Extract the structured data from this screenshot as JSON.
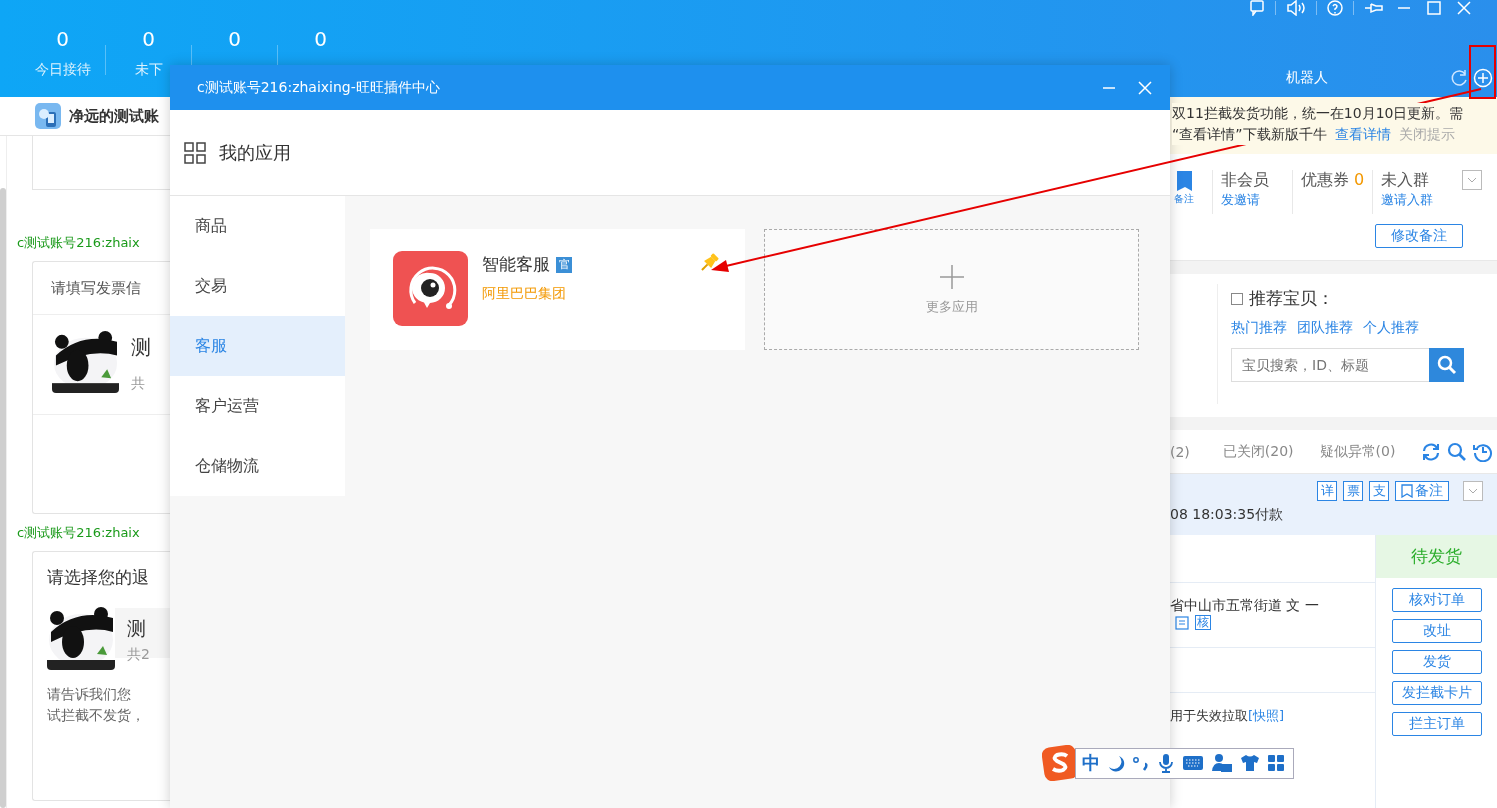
{
  "header": {
    "stats": [
      {
        "value": "0",
        "label": "今日接待"
      },
      {
        "value": "0",
        "label": "未下"
      },
      {
        "value": "0"
      },
      {
        "value": "0"
      }
    ],
    "robot_label": "机器人"
  },
  "chat": {
    "contact": "净远的测试账",
    "messages": [
      {
        "kind": "stub"
      },
      {
        "kind": "invoice",
        "sender": "c测试账号216:zhaix",
        "title": "请填写发票信",
        "item_name": "测",
        "item_meta": "共"
      },
      {
        "kind": "refund",
        "sender": "c测试账号216:zhaix",
        "title": "请选择您的退",
        "item_name": "测",
        "item_meta": "共2",
        "body_lines": [
          "请告诉我们您",
          "试拦截不发货，"
        ]
      }
    ]
  },
  "dialog": {
    "title": "c测试账号216:zhaixing-旺旺插件中心",
    "heading": "我的应用",
    "categories": [
      {
        "label": "商品",
        "selected": false
      },
      {
        "label": "交易",
        "selected": false
      },
      {
        "label": "客服",
        "selected": true
      },
      {
        "label": "客户运营",
        "selected": false
      },
      {
        "label": "仓储物流",
        "selected": false
      }
    ],
    "apps": [
      {
        "name": "智能客服",
        "badge": "官",
        "vendor": "阿里巴巴集团",
        "pinned": true
      }
    ],
    "more_label": "更多应用"
  },
  "notice": {
    "text_lines": [
      "双11拦截发货功能，统一在10月10日更新。需",
      "“查看详情”下载新版千牛"
    ],
    "link": "查看详情",
    "dismiss": "关闭提示"
  },
  "customer": {
    "flag_label": "备注",
    "membership": "非会员",
    "invite": "发邀请",
    "coupon_label": "优惠券",
    "coupon_count": "0",
    "group": "未入群",
    "group_invite": "邀请入群",
    "edit_note": "修改备注"
  },
  "recommend": {
    "title": "推荐宝贝：",
    "checked": false,
    "links": [
      "热门推荐",
      "团队推荐",
      "个人推荐"
    ],
    "search_placeholder": "宝贝搜索，ID、标题"
  },
  "order_tabs": [
    {
      "label": "(2)"
    },
    {
      "label": "已关闭(20)"
    },
    {
      "label": "疑似异常(0)"
    }
  ],
  "order": {
    "tags": [
      "详",
      "票",
      "支"
    ],
    "note_button": "备注",
    "paid_time": "08 18:03:35付款",
    "status": "待发货",
    "address": "省中山市五常街道 文 一",
    "address_tag": "核",
    "snapshot_text": "用于失效拉取",
    "snapshot_link": "[快照]",
    "actions": [
      "核对订单",
      "改址",
      "发货",
      "发拦截卡片",
      "拦主订单"
    ]
  },
  "ime": {
    "mode": "中"
  }
}
